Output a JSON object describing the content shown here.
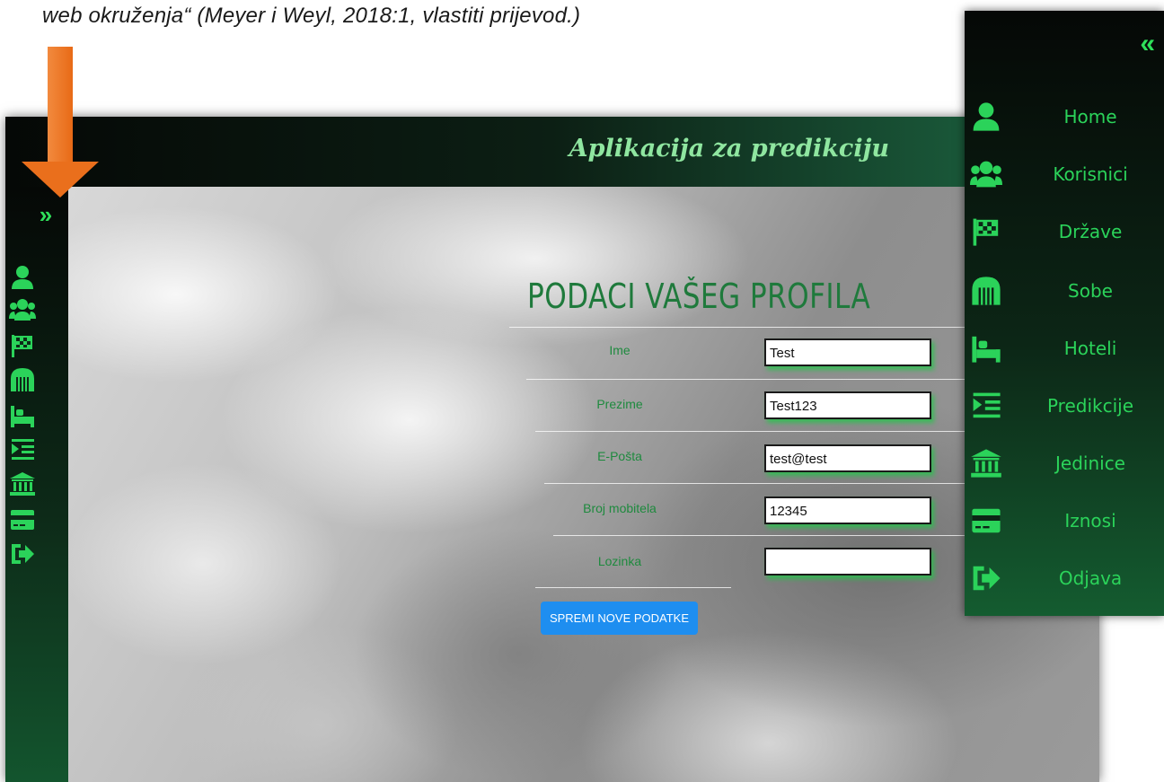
{
  "caption": {
    "text_italic": "web okruženja",
    "text_quote": "“",
    "text_citation": " (Meyer i Weyl, 2018:1, vlastiti prijevod.)"
  },
  "app": {
    "title": "Aplikacija za predikciju"
  },
  "form": {
    "title": "PODACI VAŠEG PROFILA",
    "fields": [
      {
        "label": "Ime",
        "value": "Test"
      },
      {
        "label": "Prezime",
        "value": "Test123"
      },
      {
        "label": "E-Pošta",
        "value": "test@test"
      },
      {
        "label": "Broj mobitela",
        "value": "12345"
      },
      {
        "label": "Lozinka",
        "value": ""
      }
    ],
    "save_label": "SPREMI NOVE PODATKE"
  },
  "sidebar": {
    "expand_glyph": "»",
    "collapse_glyph": "«",
    "items": [
      {
        "label": "Home",
        "icon": "user-icon"
      },
      {
        "label": "Korisnici",
        "icon": "users-icon"
      },
      {
        "label": "Države",
        "icon": "flag-icon"
      },
      {
        "label": "Sobe",
        "icon": "door-icon"
      },
      {
        "label": "Hoteli",
        "icon": "bed-icon"
      },
      {
        "label": "Predikcije",
        "icon": "indent-list-icon"
      },
      {
        "label": "Jedinice",
        "icon": "bank-icon"
      },
      {
        "label": "Iznosi",
        "icon": "credit-card-icon"
      },
      {
        "label": "Odjava",
        "icon": "sign-out-icon"
      }
    ]
  },
  "colors": {
    "accent_green": "#2bd35a",
    "label_green": "#1e8a3e",
    "button_blue": "#1e8ef0",
    "arrow_orange": "#ea6f1c"
  }
}
